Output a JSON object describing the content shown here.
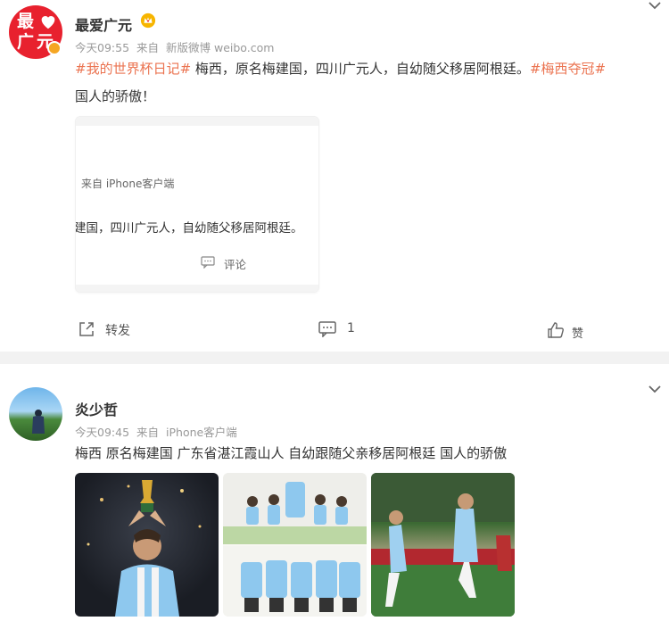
{
  "posts": [
    {
      "avatar_text": [
        "最",
        "广",
        "元"
      ],
      "username": "最爱广元",
      "time": "今天09:55",
      "from_label": "来自",
      "source": "新版微博 weibo.com",
      "tag1": "#我的世界杯日记#",
      "text1": " 梅西，原名梅建国，四川广元人，自幼随父移居阿根廷。",
      "tag2": "#梅西夺冠#",
      "text2": "国人的骄傲！",
      "card": {
        "source": "来自 iPhone客户端",
        "text": "建国，四川广元人，自幼随父移居阿根廷。",
        "comment_label": "评论"
      },
      "actions": {
        "repost_label": "转发",
        "comment_count": "1",
        "like_label": "赞"
      }
    },
    {
      "username": "炎少哲",
      "time": "今天09:45",
      "from_label": "来自",
      "source": "iPhone客户端",
      "text": "梅西 原名梅建国 广东省湛江霞山人 自幼跟随父亲移居阿根廷 国人的骄傲"
    }
  ],
  "icons": {
    "crown": "crown-icon",
    "verified": "verified-badge-icon",
    "chevron": "chevron-down-icon",
    "repost": "repost-icon",
    "comment": "comment-icon",
    "like": "like-icon"
  },
  "colors": {
    "tag": "#eb7350",
    "brand_red": "#e8212e",
    "meta_gray": "#999999"
  }
}
